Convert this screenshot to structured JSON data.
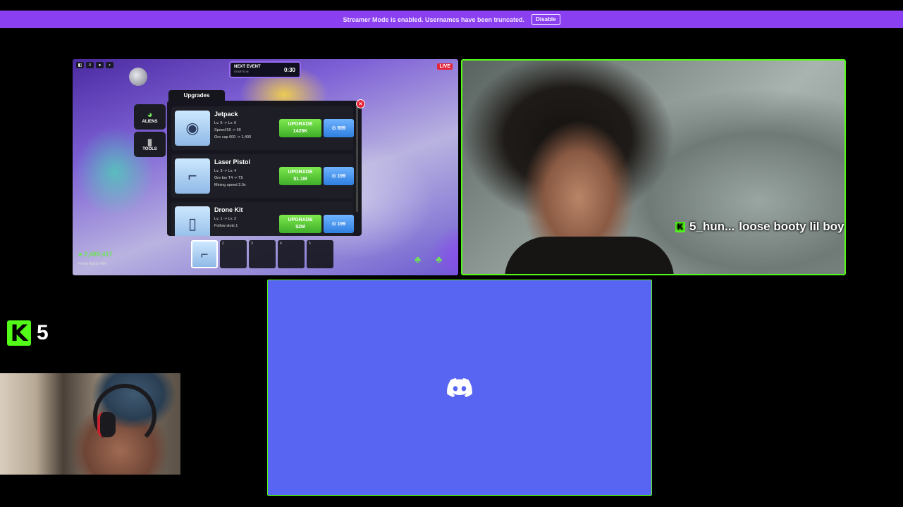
{
  "banner": {
    "message": "Streamer Mode is enabled. Usernames have been truncated.",
    "button_label": "Disable",
    "color": "#8a3ff0"
  },
  "game": {
    "event": {
      "title": "NEXT EVENT",
      "subtitle": "STARTS IN",
      "time": "0:30"
    },
    "live_label": "LIVE",
    "side_buttons": [
      {
        "label": "ALIENS",
        "icon": "alien-icon"
      },
      {
        "label": "TOOLS",
        "icon": "tools-icon"
      }
    ],
    "upgrades_title": "Upgrades",
    "upgrades": [
      {
        "name": "Jetpack",
        "stats": [
          "Lv. 5 -> Lv. 6",
          "Speed 59 -> 66",
          "Ore cap 600 -> 1,400"
        ],
        "upgrade_label": "UPGRADE",
        "price": "1425K",
        "gems": "699"
      },
      {
        "name": "Laser Pistol",
        "stats": [
          "Lv. 3 -> Lv. 4",
          "Ore tier T4 -> T5",
          "Mining speed 2.0x"
        ],
        "upgrade_label": "UPGRADE",
        "price": "$1.1M",
        "gems": "199"
      },
      {
        "name": "Drone Kit",
        "stats": [
          "Lv. 1 -> Lv. 2",
          "Follow slots 1"
        ],
        "upgrade_label": "UPGRADE",
        "price": "$2M",
        "gems": "199"
      }
    ],
    "hotbar_slots": [
      "",
      "2",
      "3",
      "4",
      "5"
    ],
    "currency": "2,485,417",
    "boost": "Friend Boost +0%"
  },
  "chat": {
    "username": "5_hun...",
    "message": "loose booty lil boy",
    "badge": "K"
  },
  "kick": {
    "logo": "K",
    "count": "5",
    "color": "#53fc18"
  },
  "discord": {
    "color": "#5865f2"
  }
}
